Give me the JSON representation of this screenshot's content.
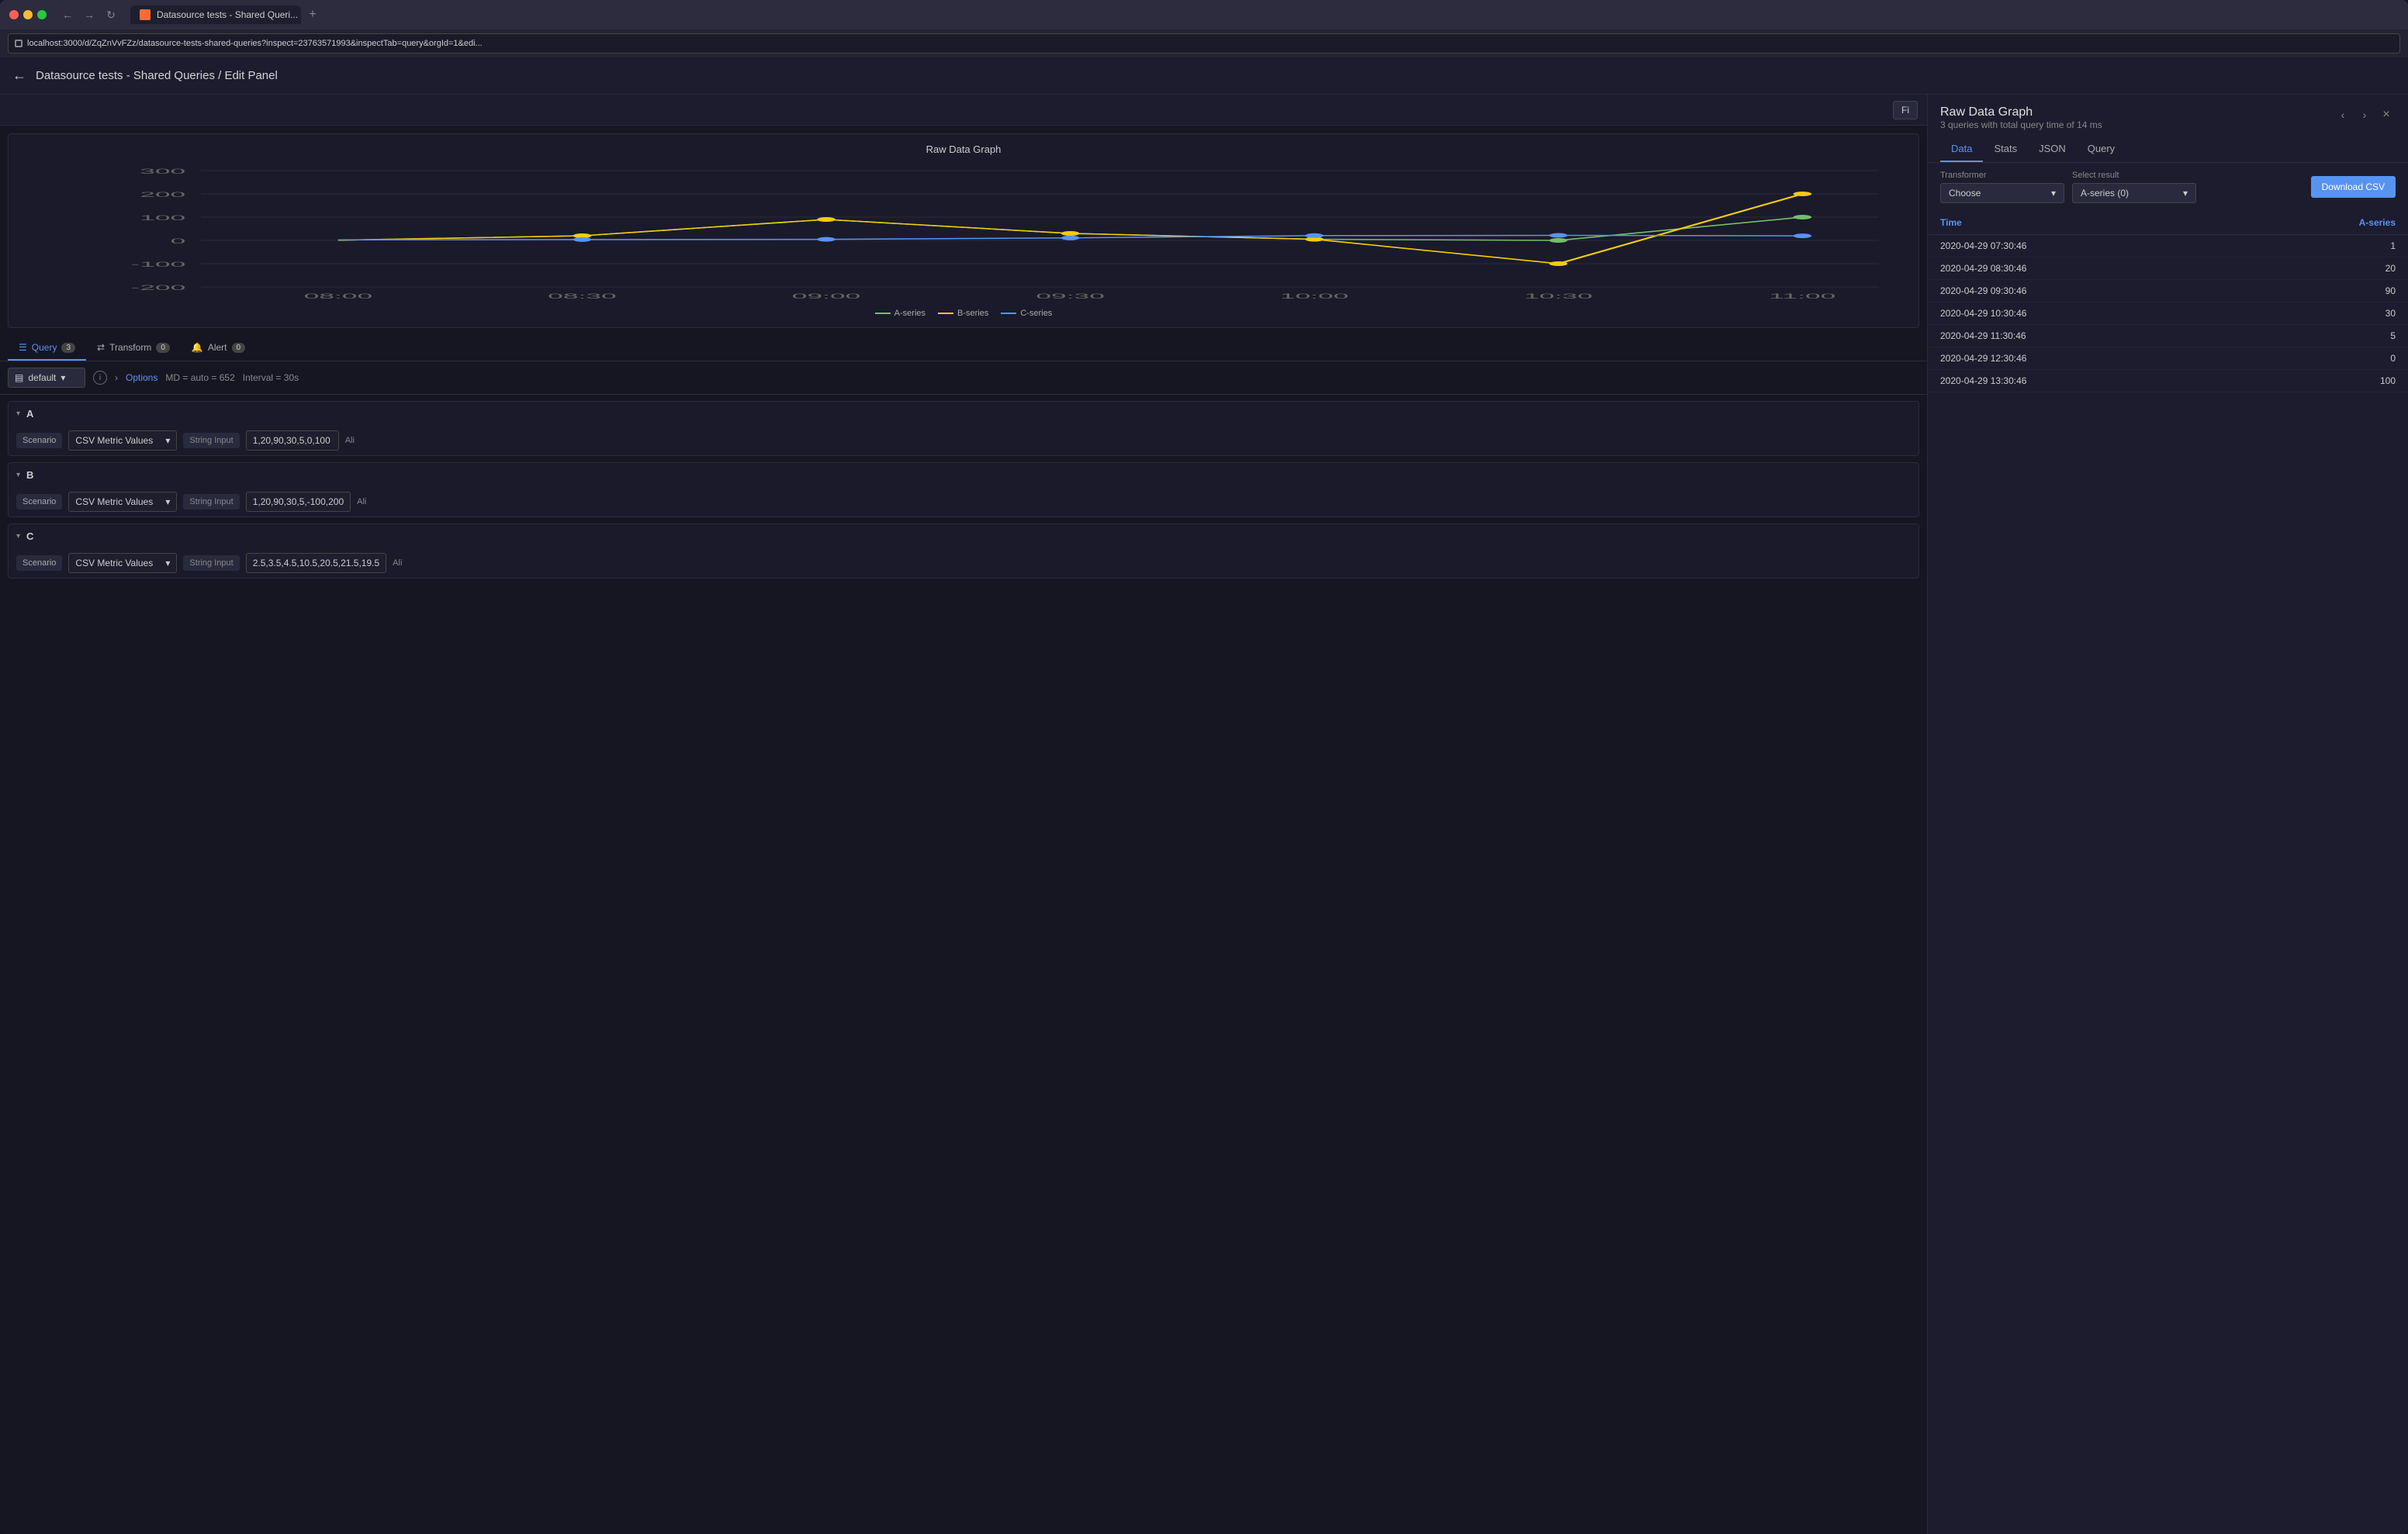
{
  "browser": {
    "tab_title": "Datasource tests - Shared Queri...",
    "url": "localhost:3000/d/ZqZnVvFZz/datasource-tests-shared-queries?inspect=23763571993&inspectTab=query&orgId=1&edi...",
    "new_tab_label": "+",
    "back_label": "←",
    "forward_label": "→",
    "reload_label": "↻"
  },
  "app": {
    "back_label": "←",
    "breadcrumb": "Datasource tests - Shared Queries / Edit Panel",
    "toolbar_button": "Fi"
  },
  "chart": {
    "title": "Raw Data Graph",
    "y_labels": [
      "300",
      "200",
      "100",
      "0",
      "-100",
      "-200"
    ],
    "x_labels": [
      "08:00",
      "08:30",
      "09:00",
      "09:30",
      "10:00",
      "10:30",
      "11:00"
    ],
    "legend": [
      {
        "label": "A-series",
        "color": "#73bf69"
      },
      {
        "label": "B-series",
        "color": "#f2cc0c"
      },
      {
        "label": "C-series",
        "color": "#5794f2"
      }
    ]
  },
  "query_tabs": [
    {
      "label": "Query",
      "badge": "3",
      "active": true
    },
    {
      "label": "Transform",
      "badge": "0",
      "active": false
    },
    {
      "label": "Alert",
      "badge": "0",
      "active": false
    }
  ],
  "query_options": {
    "datasource": "default",
    "options_label": "Options",
    "md_label": "MD = auto = 652",
    "interval_label": "Interval = 30s"
  },
  "query_rows": [
    {
      "label": "A",
      "scenario_label": "Scenario",
      "metric": "CSV Metric Values",
      "string_input": "String Input",
      "value": "1,20,90,30,5,0,100",
      "alias_label": "Ali"
    },
    {
      "label": "B",
      "scenario_label": "Scenario",
      "metric": "CSV Metric Values",
      "string_input": "String Input",
      "value": "1,20,90,30,5,-100,200",
      "alias_label": "Ali"
    },
    {
      "label": "C",
      "scenario_label": "Scenario",
      "metric": "CSV Metric Values",
      "string_input": "String Input",
      "value": "2.5,3.5,4.5,10.5,20.5,21.5,19.5",
      "alias_label": "Ali"
    }
  ],
  "right_panel": {
    "title": "Raw Data Graph",
    "subtitle": "3 queries with total query time of 14 ms",
    "close_label": "×",
    "prev_label": "‹",
    "next_label": "›",
    "tabs": [
      {
        "label": "Data",
        "active": true
      },
      {
        "label": "Stats",
        "active": false
      },
      {
        "label": "JSON",
        "active": false
      },
      {
        "label": "Query",
        "active": false
      }
    ],
    "transformer_label": "Transformer",
    "transformer_placeholder": "Choose",
    "select_result_label": "Select result",
    "select_result_value": "A-series (0)",
    "download_csv_label": "Download CSV",
    "table_headers": [
      "Time",
      "A-series"
    ],
    "table_rows": [
      {
        "time": "2020-04-29 07:30:46",
        "value": "1"
      },
      {
        "time": "2020-04-29 08:30:46",
        "value": "20"
      },
      {
        "time": "2020-04-29 09:30:46",
        "value": "90"
      },
      {
        "time": "2020-04-29 10:30:46",
        "value": "30"
      },
      {
        "time": "2020-04-29 11:30:46",
        "value": "5"
      },
      {
        "time": "2020-04-29 12:30:46",
        "value": "0"
      },
      {
        "time": "2020-04-29 13:30:46",
        "value": "100"
      }
    ]
  }
}
